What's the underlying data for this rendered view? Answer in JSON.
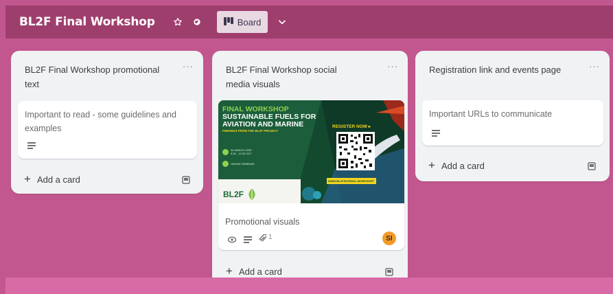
{
  "header": {
    "board_title": "BL2F Final Workshop",
    "view_label": "Board"
  },
  "lists": [
    {
      "title": "BL2F Final Workshop promotional text",
      "menu": "···",
      "cards": [
        {
          "title": "Important to read - some guidelines and examples",
          "has_description": true
        }
      ],
      "add_card_label": "Add a card"
    },
    {
      "title": "BL2F Final Workshop social media visuals",
      "menu": "···",
      "cards": [
        {
          "title": "Promotional visuals",
          "attachments_count": "1",
          "member_initials": "SI",
          "cover": {
            "line1": "FINAL WORKSHOP",
            "line2": "SUSTAINABLE FUELS FOR",
            "line3": "AVIATION AND MARINE",
            "line4": "FINDINGS FROM THE BL2F PROJECT",
            "register": "REGISTER NOW ▸",
            "date_text": "24 MARCH 2025 · 9:30 - 12:30 CET",
            "online_text": "ONLINE WEBINAR",
            "logo_text": "BL2F",
            "url_text": "WWW.BL2F.EU/FINAL-WORKSHOP"
          }
        }
      ],
      "add_card_label": "Add a card"
    },
    {
      "title": "Registration link and events page",
      "menu": "···",
      "cards": [
        {
          "title": "Important URLs to communicate",
          "has_description": true
        }
      ],
      "add_card_label": "Add a card"
    }
  ],
  "colors": {
    "board_bg": "#c2578f",
    "header_bg": "#9e3e6d",
    "list_bg": "#f1f2f4",
    "avatar": "#f39a2a",
    "cover_green": "#13492f"
  }
}
